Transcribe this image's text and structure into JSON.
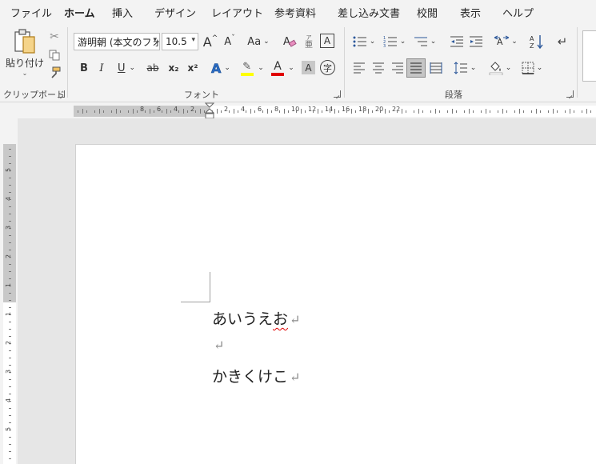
{
  "tabs": [
    "ファイル",
    "ホーム",
    "挿入",
    "デザイン",
    "レイアウト",
    "参考資料",
    "差し込み文書",
    "校閲",
    "表示",
    "ヘルプ"
  ],
  "active_tab": "ホーム",
  "ribbon": {
    "clipboard": {
      "group_label": "クリップボード",
      "paste_label": "貼り付け"
    },
    "font": {
      "group_label": "フォント",
      "font_name": "游明朝 (本文のフォ",
      "font_size": "10.5",
      "bold": "B",
      "italic": "I",
      "underline": "U",
      "strikethrough": "ab",
      "subscript": "x₂",
      "superscript": "x²",
      "grow": "A",
      "shrink": "A",
      "case": "Aa",
      "phonetic_top": "ア",
      "phonetic_bottom": "亜",
      "boxed": "A",
      "effects": "A",
      "font_color": "A",
      "shading": "A",
      "enclosed": "字"
    },
    "paragraph": {
      "group_label": "段落"
    }
  },
  "ruler": {
    "h_labels": [
      "8",
      "6",
      "4",
      "2",
      "2",
      "4",
      "6",
      "8",
      "10",
      "12",
      "14",
      "16",
      "18",
      "20",
      "22"
    ],
    "v_labels": [
      "5",
      "4",
      "3",
      "2",
      "1",
      "1",
      "2",
      "3",
      "4",
      "5"
    ]
  },
  "document": {
    "paragraphs": [
      "あいうえお",
      "",
      "かきくけこ"
    ],
    "squiggle_part": "お",
    "paragraph_mark": "↵"
  },
  "colors": {
    "highlight": "#ffff00",
    "font_color": "#e00000",
    "accent": "#2b579a"
  }
}
